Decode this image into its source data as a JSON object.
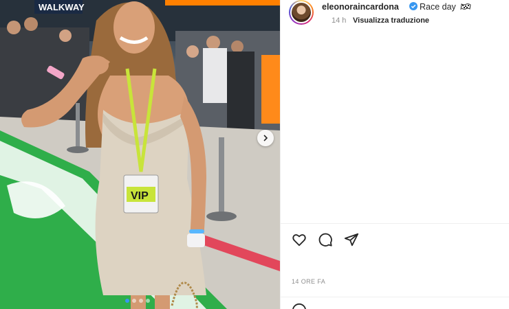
{
  "post": {
    "username": "eleonoraincardona",
    "caption": "Race day",
    "caption_emoji": "flag-icon",
    "time_ago": "14 h",
    "translate_label": "Visualizza traduzione",
    "timestamp": "14 ORE FA"
  },
  "photo": {
    "banner_text": "WALKWAY",
    "badge_text": "VIP",
    "carousel_count": 4,
    "carousel_active": 0
  },
  "actions": [
    "heart-icon",
    "comment-icon",
    "share-icon"
  ],
  "colors": {
    "verified": "#3897f0",
    "accent_green": "#35b34a",
    "text": "#262626",
    "muted": "#8e8e8e"
  }
}
